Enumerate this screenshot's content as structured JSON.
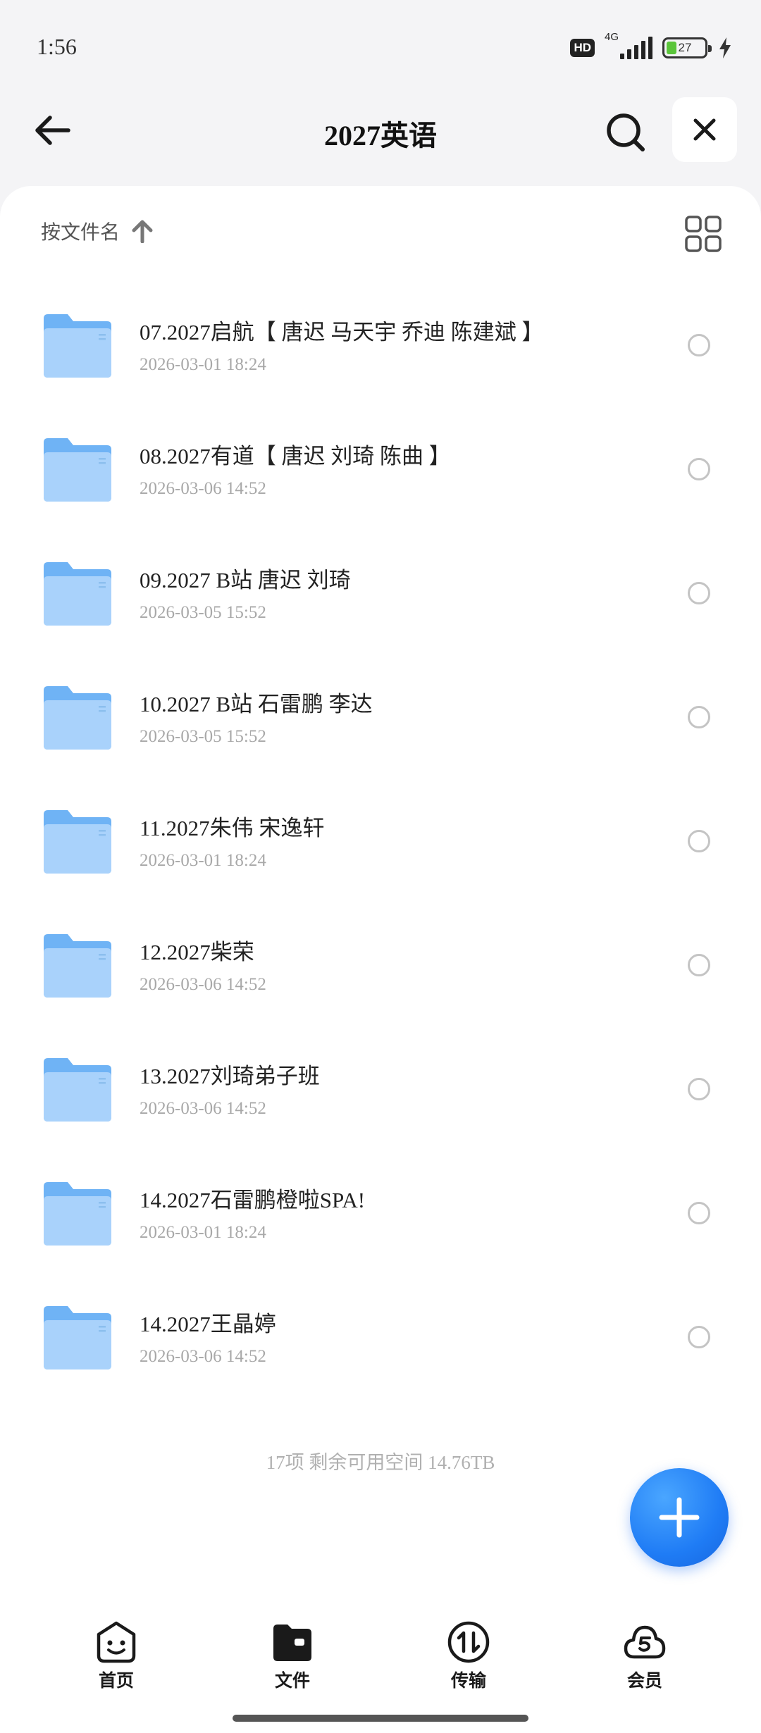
{
  "status_bar": {
    "time": "1:56",
    "hd_label": "HD",
    "network_label": "4G",
    "battery_text": "27",
    "battery_level_percent": 27
  },
  "header": {
    "title": "2027英语",
    "back_icon": "arrow-left-icon",
    "search_icon": "search-icon",
    "close_icon": "close-icon"
  },
  "toolbar": {
    "sort_label": "按文件名",
    "sort_icon": "arrow-up-icon",
    "view_icon": "grid-view-icon"
  },
  "files": [
    {
      "name": "07.2027启航【 唐迟 马天宇 乔迪 陈建斌 】",
      "date": "2026-03-01 18:24"
    },
    {
      "name": "08.2027有道【 唐迟 刘琦 陈曲 】",
      "date": "2026-03-06 14:52"
    },
    {
      "name": "09.2027 B站 唐迟 刘琦",
      "date": "2026-03-05 15:52"
    },
    {
      "name": "10.2027 B站 石雷鹏 李达",
      "date": "2026-03-05 15:52"
    },
    {
      "name": "11.2027朱伟 宋逸轩",
      "date": "2026-03-01 18:24"
    },
    {
      "name": "12.2027柴荣",
      "date": "2026-03-06 14:52"
    },
    {
      "name": "13.2027刘琦弟子班",
      "date": "2026-03-06 14:52"
    },
    {
      "name": "14.2027石雷鹏橙啦SPA!",
      "date": "2026-03-01 18:24"
    },
    {
      "name": "14.2027王晶婷",
      "date": "2026-03-06 14:52"
    }
  ],
  "footer": {
    "summary": "17项 剩余可用空间 14.76TB"
  },
  "fab": {
    "icon": "plus-icon"
  },
  "bottom_nav": {
    "items": [
      {
        "label": "首页",
        "icon": "home-face-icon"
      },
      {
        "label": "文件",
        "icon": "folder-icon"
      },
      {
        "label": "传输",
        "icon": "transfer-icon"
      },
      {
        "label": "会员",
        "icon": "vip-cloud-icon"
      }
    ],
    "active_index": 1
  },
  "colors": {
    "accent": "#1f7cf5",
    "folder_light": "#a9d2fb",
    "folder_dark": "#6fb3f5",
    "background": "#f4f4f6"
  }
}
